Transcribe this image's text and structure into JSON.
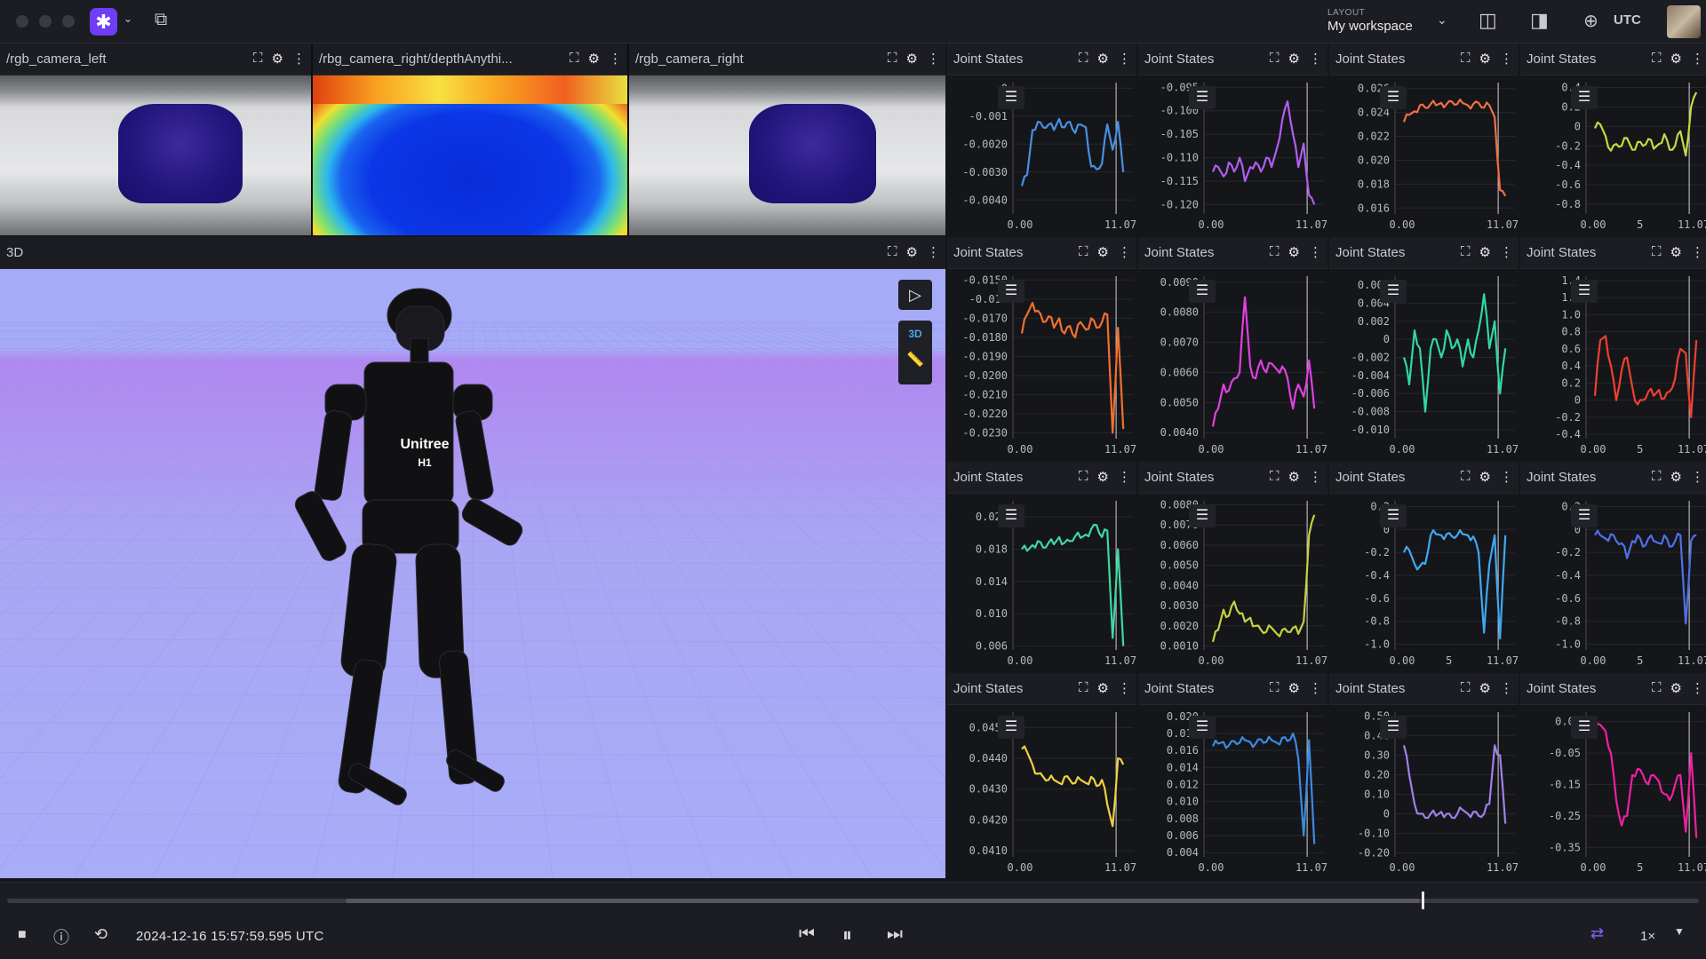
{
  "app": {
    "layout_small": "LAYOUT",
    "layout_name": "My workspace",
    "timezone": "UTC"
  },
  "cameras": [
    {
      "title": "/rgb_camera_left"
    },
    {
      "title": "/rbg_camera_right/depthAnythi..."
    },
    {
      "title": "/rgb_camera_right"
    }
  ],
  "view3d": {
    "title": "3D",
    "mode_label": "3D",
    "robot_brand": "Unitree",
    "robot_model": "H1"
  },
  "plots": [
    {
      "title": "Joint States",
      "color": "#4a8fe0",
      "yticks": [
        "0",
        "-0.001",
        "-0.0020",
        "-0.0030",
        "-0.0040"
      ],
      "xticks": [
        "0.00",
        "11.07"
      ],
      "ylim": [
        -0.0045,
        0.0002
      ],
      "values": [
        -0.0035,
        -0.0031,
        -0.0015,
        -0.0012,
        -0.0014,
        -0.0013,
        -0.0015,
        -0.0011,
        -0.0014,
        -0.0012,
        -0.0016,
        -0.0013,
        -0.0014,
        -0.0028,
        -0.0029,
        -0.0027,
        -0.0013,
        -0.0022,
        -0.0012,
        -0.003
      ]
    },
    {
      "title": "Joint States",
      "color": "#b05ef0",
      "yticks": [
        "-0.095",
        "-0.100",
        "-0.105",
        "-0.110",
        "-0.115",
        "-0.120"
      ],
      "xticks": [
        "0.00",
        "11.07"
      ],
      "ylim": [
        -0.122,
        -0.094
      ],
      "values": [
        -0.113,
        -0.112,
        -0.114,
        -0.111,
        -0.113,
        -0.11,
        -0.115,
        -0.112,
        -0.111,
        -0.113,
        -0.11,
        -0.112,
        -0.108,
        -0.102,
        -0.098,
        -0.105,
        -0.112,
        -0.107,
        -0.118,
        -0.12
      ]
    },
    {
      "title": "Joint States",
      "color": "#f07040",
      "yticks": [
        "0.026",
        "0.024",
        "0.022",
        "0.020",
        "0.018",
        "0.016"
      ],
      "xticks": [
        "0.00",
        "11.07"
      ],
      "ylim": [
        0.0155,
        0.0265
      ],
      "values": [
        0.0232,
        0.0238,
        0.0241,
        0.0246,
        0.0244,
        0.0247,
        0.0246,
        0.0248,
        0.0247,
        0.0249,
        0.0247,
        0.0248,
        0.0246,
        0.0247,
        0.0248,
        0.0244,
        0.0246,
        0.0236,
        0.0175,
        0.017
      ]
    },
    {
      "title": "Joint States",
      "color": "#c8d840",
      "yticks": [
        "0.4",
        "0.2",
        "0",
        "-0.2",
        "-0.4",
        "-0.6",
        "-0.8"
      ],
      "xticks": [
        "0.00",
        "5",
        "11.07"
      ],
      "ylim": [
        -0.9,
        0.45
      ],
      "values": [
        -0.02,
        0.02,
        -0.1,
        -0.25,
        -0.18,
        -0.2,
        -0.12,
        -0.24,
        -0.16,
        -0.2,
        -0.13,
        -0.23,
        -0.18,
        -0.08,
        -0.24,
        -0.2,
        -0.05,
        -0.3,
        0.2,
        0.35
      ]
    },
    {
      "title": "Joint States",
      "color": "#f07030",
      "yticks": [
        "-0.0150",
        "-0.016",
        "-0.0170",
        "-0.0180",
        "-0.0190",
        "-0.0200",
        "-0.0210",
        "-0.0220",
        "-0.0230"
      ],
      "xticks": [
        "0.00",
        "11.07"
      ],
      "ylim": [
        -0.0233,
        -0.0148
      ],
      "values": [
        -0.0178,
        -0.0168,
        -0.0162,
        -0.0166,
        -0.0172,
        -0.0169,
        -0.0175,
        -0.017,
        -0.0178,
        -0.0174,
        -0.018,
        -0.0172,
        -0.0176,
        -0.017,
        -0.0175,
        -0.0172,
        -0.0168,
        -0.023,
        -0.0175,
        -0.0228
      ]
    },
    {
      "title": "Joint States",
      "color": "#e040e0",
      "yticks": [
        "0.0090",
        "0.0080",
        "0.0070",
        "0.0060",
        "0.0050",
        "0.0040"
      ],
      "xticks": [
        "0.00",
        "11.07"
      ],
      "ylim": [
        0.0038,
        0.0092
      ],
      "values": [
        0.0042,
        0.0048,
        0.0056,
        0.0054,
        0.0058,
        0.006,
        0.0085,
        0.0062,
        0.0058,
        0.0064,
        0.006,
        0.0063,
        0.0061,
        0.0062,
        0.0058,
        0.0048,
        0.0056,
        0.0052,
        0.0064,
        0.0048
      ]
    },
    {
      "title": "Joint States",
      "color": "#30d8a0",
      "yticks": [
        "0.006",
        "0.004",
        "0.002",
        "0",
        "-0.002",
        "-0.004",
        "-0.006",
        "-0.008",
        "-0.010"
      ],
      "xticks": [
        "0.00",
        "11.07"
      ],
      "ylim": [
        -0.011,
        0.007
      ],
      "values": [
        -0.002,
        -0.005,
        0.001,
        -0.001,
        -0.008,
        -0.001,
        0.0,
        -0.002,
        0.001,
        -0.001,
        0.0,
        -0.003,
        0.0,
        -0.002,
        0.001,
        0.005,
        -0.001,
        0.002,
        -0.006,
        -0.001
      ]
    },
    {
      "title": "Joint States",
      "color": "#f04030",
      "yticks": [
        "1.4",
        "1.2",
        "1.0",
        "0.8",
        "0.6",
        "0.4",
        "0.2",
        "0",
        "-0.2",
        "-0.4"
      ],
      "xticks": [
        "0.00",
        "5",
        "11.07"
      ],
      "ylim": [
        -0.45,
        1.45
      ],
      "values": [
        0.05,
        0.7,
        0.75,
        0.4,
        0.0,
        0.35,
        0.5,
        0.15,
        -0.05,
        0.0,
        0.1,
        0.05,
        0.12,
        0.02,
        0.1,
        0.25,
        0.6,
        0.55,
        -0.2,
        0.7
      ]
    },
    {
      "title": "Joint States",
      "color": "#40d8a0",
      "yticks": [
        "0.022",
        "0.018",
        "0.014",
        "0.010",
        "0.006"
      ],
      "xticks": [
        "0.00",
        "11.07"
      ],
      "ylim": [
        0.0055,
        0.024
      ],
      "values": [
        0.018,
        0.0178,
        0.0185,
        0.019,
        0.0182,
        0.0188,
        0.0186,
        0.0195,
        0.0188,
        0.019,
        0.0196,
        0.0194,
        0.0198,
        0.0205,
        0.021,
        0.0195,
        0.0203,
        0.007,
        0.018,
        0.006
      ]
    },
    {
      "title": "Joint States",
      "color": "#c8d040",
      "yticks": [
        "0.0080",
        "0.0070",
        "0.0060",
        "0.0050",
        "0.0040",
        "0.0030",
        "0.0020",
        "0.0010"
      ],
      "xticks": [
        "0.00",
        "11.07"
      ],
      "ylim": [
        0.0008,
        0.0082
      ],
      "values": [
        0.0012,
        0.0018,
        0.0028,
        0.0025,
        0.0032,
        0.0026,
        0.0022,
        0.0024,
        0.002,
        0.0018,
        0.0017,
        0.0019,
        0.0016,
        0.0018,
        0.0017,
        0.0019,
        0.0016,
        0.0022,
        0.0065,
        0.0075
      ]
    },
    {
      "title": "Joint States",
      "color": "#40a8f0",
      "yticks": [
        "0.2",
        "0",
        "-0.2",
        "-0.4",
        "-0.6",
        "-0.8",
        "-1.0"
      ],
      "xticks": [
        "0.00",
        "5",
        "11.07"
      ],
      "ylim": [
        -1.05,
        0.25
      ],
      "values": [
        -0.2,
        -0.18,
        -0.3,
        -0.32,
        -0.3,
        -0.05,
        -0.04,
        -0.05,
        -0.04,
        -0.06,
        -0.05,
        -0.04,
        -0.05,
        -0.06,
        -0.2,
        -0.9,
        -0.3,
        -0.05,
        -0.95,
        -0.05
      ]
    },
    {
      "title": "Joint States",
      "color": "#5070e8",
      "yticks": [
        "0.2",
        "0",
        "-0.2",
        "-0.4",
        "-0.6",
        "-0.8",
        "-1.0"
      ],
      "xticks": [
        "0.00",
        "5",
        "11.07"
      ],
      "ylim": [
        -1.05,
        0.25
      ],
      "values": [
        -0.05,
        -0.05,
        -0.08,
        -0.04,
        -0.1,
        -0.12,
        -0.25,
        -0.1,
        -0.05,
        -0.15,
        -0.08,
        -0.1,
        -0.12,
        -0.05,
        -0.15,
        -0.1,
        -0.05,
        -0.82,
        -0.1,
        -0.05
      ]
    },
    {
      "title": "Joint States",
      "color": "#f0d040",
      "yticks": [
        "0.0450",
        "0.0440",
        "0.0430",
        "0.0420",
        "0.0410"
      ],
      "xticks": [
        "0.00",
        "11.07"
      ],
      "ylim": [
        0.0408,
        0.0455
      ],
      "values": [
        0.0443,
        0.0442,
        0.0438,
        0.0435,
        0.0434,
        0.0433,
        0.0433,
        0.0432,
        0.0434,
        0.0433,
        0.0432,
        0.0433,
        0.0432,
        0.0434,
        0.0431,
        0.0433,
        0.0425,
        0.0418,
        0.044,
        0.0438
      ]
    },
    {
      "title": "Joint States",
      "color": "#3c8ae0",
      "yticks": [
        "0.020",
        "0.018",
        "0.016",
        "0.014",
        "0.012",
        "0.010",
        "0.008",
        "0.006",
        "0.004"
      ],
      "xticks": [
        "0.00",
        "11.07"
      ],
      "ylim": [
        0.0035,
        0.0205
      ],
      "values": [
        0.0165,
        0.0168,
        0.017,
        0.0166,
        0.0171,
        0.0169,
        0.0172,
        0.017,
        0.0168,
        0.0173,
        0.017,
        0.0172,
        0.0169,
        0.0175,
        0.0171,
        0.018,
        0.015,
        0.006,
        0.0172,
        0.005
      ]
    },
    {
      "title": "Joint States",
      "color": "#a080e8",
      "yticks": [
        "0.50",
        "0.40",
        "0.30",
        "0.20",
        "0.10",
        "0",
        "-0.10",
        "-0.20"
      ],
      "xticks": [
        "0.00",
        "11.07"
      ],
      "ylim": [
        -0.22,
        0.52
      ],
      "values": [
        0.35,
        0.2,
        0.05,
        0.0,
        -0.02,
        0.0,
        -0.01,
        0.01,
        0.0,
        -0.02,
        0.0,
        0.02,
        0.0,
        0.01,
        -0.01,
        0.0,
        0.05,
        0.35,
        0.3,
        -0.05
      ]
    },
    {
      "title": "Joint States",
      "color": "#f020a0",
      "yticks": [
        "0.05",
        "-0.05",
        "-0.15",
        "-0.25",
        "-0.35"
      ],
      "xticks": [
        "0.00",
        "5",
        "11.07"
      ],
      "ylim": [
        -0.38,
        0.08
      ],
      "values": [
        0.02,
        0.04,
        0.02,
        -0.05,
        -0.2,
        -0.28,
        -0.25,
        -0.12,
        -0.1,
        -0.12,
        -0.15,
        -0.12,
        -0.14,
        -0.18,
        -0.2,
        -0.15,
        -0.12,
        -0.3,
        -0.05,
        -0.32
      ]
    }
  ],
  "timeline": {
    "timestamp": "2024-12-16 15:57:59.595 UTC",
    "speed": "1×",
    "progress": 0.836,
    "loaded": 0.835
  }
}
